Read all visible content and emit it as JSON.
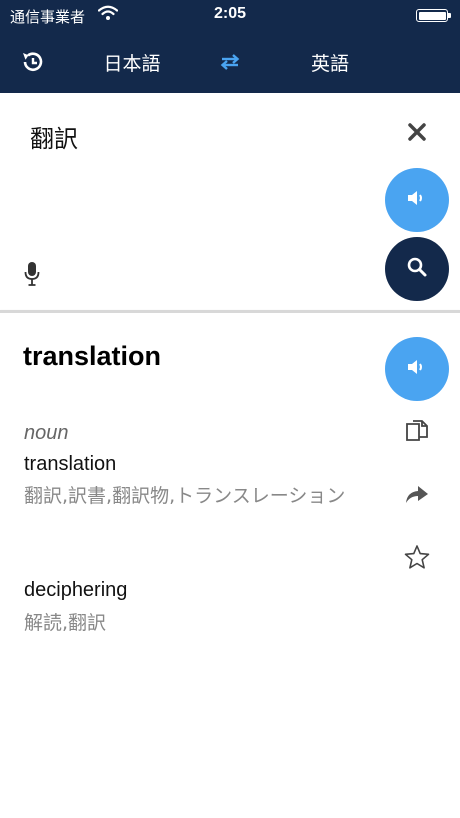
{
  "status": {
    "carrier": "通信事業者",
    "time": "2:05"
  },
  "nav": {
    "source_language": "日本語",
    "target_language": "英語"
  },
  "input": {
    "text": "翻訳"
  },
  "result": {
    "headword": "translation",
    "part_of_speech": "noun",
    "senses": [
      {
        "word": "translation",
        "synonyms": "翻訳,訳書,翻訳物,トランスレーション"
      },
      {
        "word": "deciphering",
        "synonyms": "解読,翻訳"
      }
    ]
  },
  "colors": {
    "header_bg": "#13294b",
    "accent_blue": "#4aa4f1",
    "search_bg": "#13294b"
  },
  "icons": [
    "history-icon",
    "swap-icon",
    "close-icon",
    "speaker-icon",
    "search-icon",
    "microphone-icon",
    "copy-icon",
    "share-icon",
    "star-icon"
  ]
}
